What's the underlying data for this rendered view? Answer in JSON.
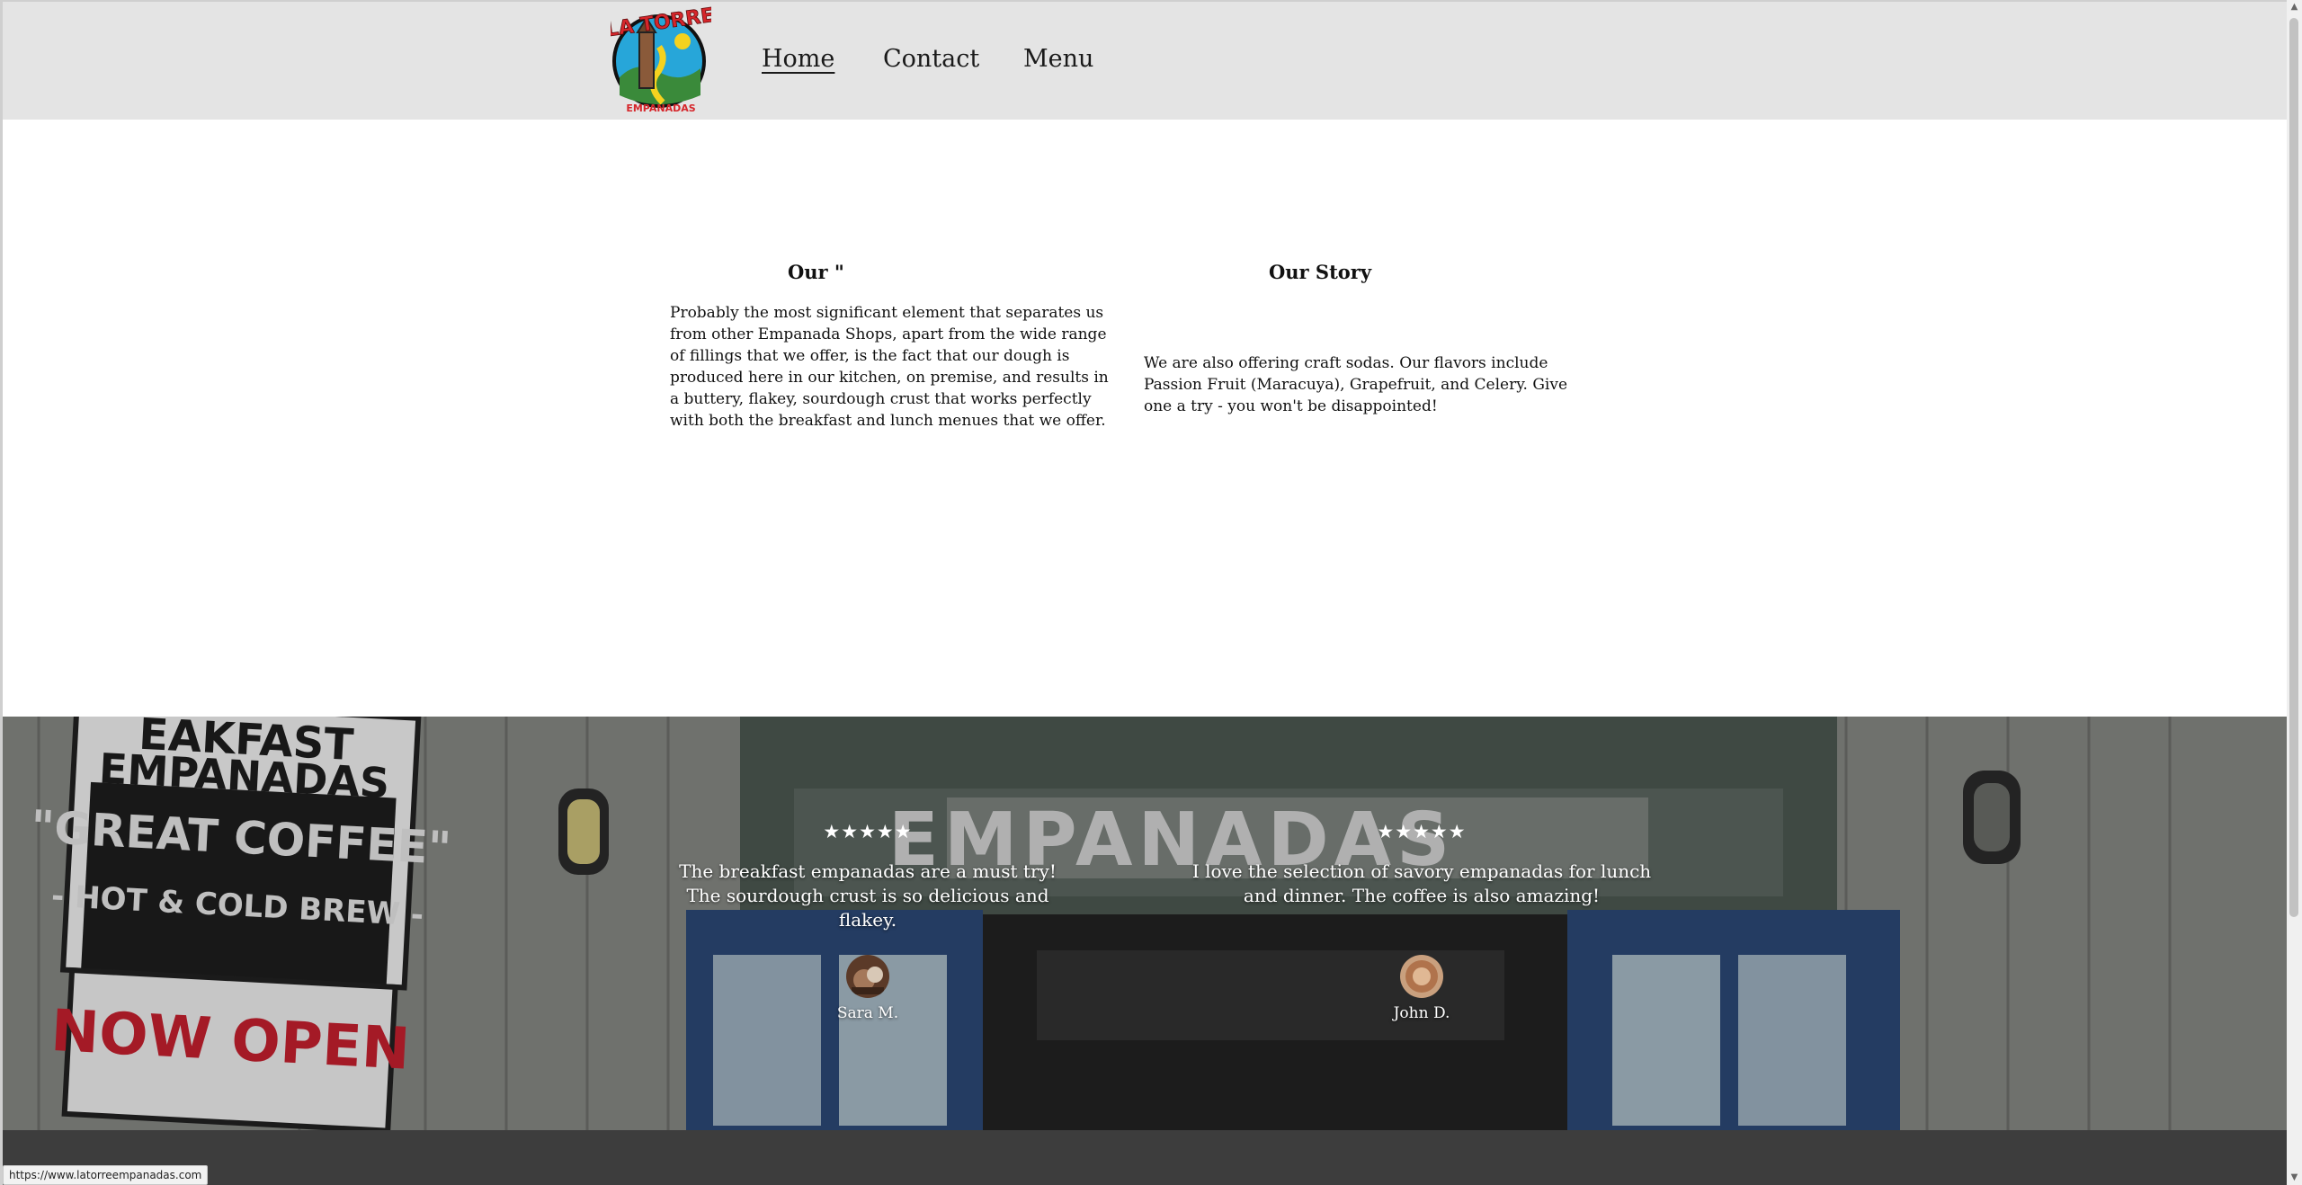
{
  "header": {
    "logo": {
      "top_text": "LA TORRE",
      "bottom_text": "EMPANADAS"
    },
    "nav": [
      {
        "label": "Home",
        "active": true
      },
      {
        "label": "Contact",
        "active": false
      },
      {
        "label": "Menu",
        "active": false
      }
    ]
  },
  "content": {
    "left": {
      "title": "Our \"",
      "body": "Probably the most significant element that separates us from other Empanada Shops, apart from the wide range of fillings that we offer, is the fact that our dough is produced here in our kitchen, on premise, and results in a buttery, flakey, sourdough crust that works perfectly with both the breakfast and lunch menues that we offer."
    },
    "right": {
      "title": "Our Story",
      "body": "We are also offering craft sodas.  Our flavors include Passion Fruit (Maracuya), Grapefruit, and Celery. Give one a try - you won't be disappointed!"
    }
  },
  "background_sign": {
    "banner_line1": "EAKFAST",
    "banner_line2": "EMPANADAS",
    "banner_line3": "\"GREAT COFFEE\"",
    "banner_line4": "- HOT & COLD BREW -",
    "banner_line5": "NOW OPEN",
    "storefront": "EMPANADAS"
  },
  "testimonials": [
    {
      "stars": "★★★★★",
      "rating": 5,
      "quote": "The breakfast empanadas are a must try! The sourdough crust is so delicious and flakey.",
      "name": "Sara M."
    },
    {
      "stars": "★★★★★",
      "rating": 5,
      "quote": "I love the selection of savory empanadas for lunch and dinner. The coffee is also amazing!",
      "name": "John D."
    }
  ],
  "status_bar": {
    "url": "https://www.latorreempanadas.com"
  },
  "colors": {
    "header_bg": "#e4e4e4",
    "footer_bg": "#3d3d3d",
    "logo_red": "#d6262b",
    "logo_blue": "#27a6d9",
    "logo_yellow": "#f5d21f"
  }
}
